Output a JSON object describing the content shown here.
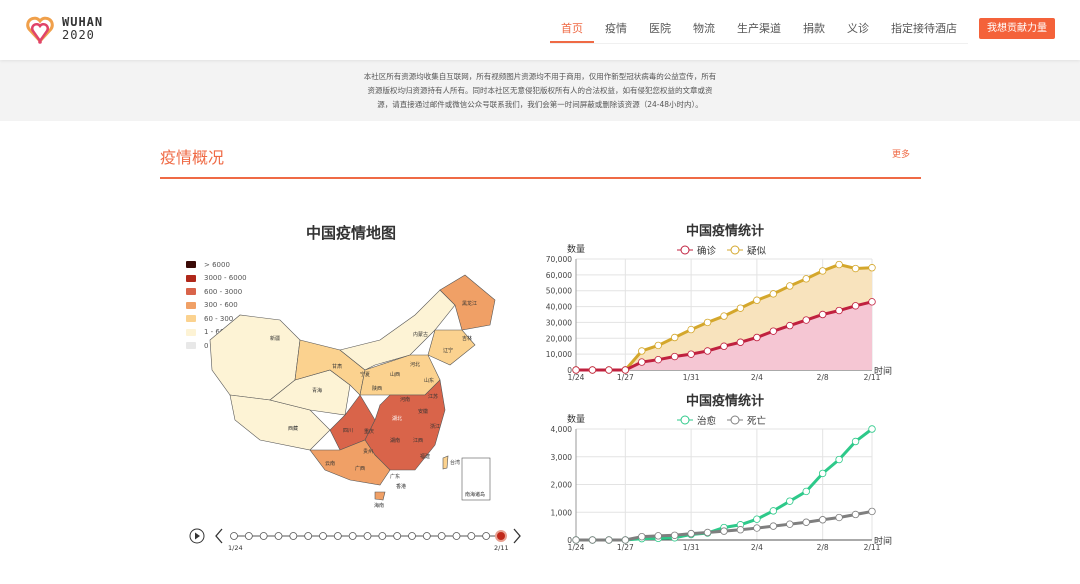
{
  "header": {
    "logo_line1": "WUHAN",
    "logo_line2": "2020",
    "nav": [
      "首页",
      "疫情",
      "医院",
      "物流",
      "生产渠道",
      "捐款",
      "义诊",
      "指定接待酒店"
    ],
    "cta": "我想贡献力量"
  },
  "notice": [
    "本社区所有资源均收集自互联网，所有视频图片资源均不用于商用，仅用作新型冠状病毒的公益宣传，所有",
    "资源版权均归资源持有人所有。同时本社区无意侵犯版权所有人的合法权益，如有侵犯您权益的文章或资",
    "源，请直接通过邮件或微信公众号联系我们，我们会第一时间屏蔽或删除该资源（24-48小时内）。"
  ],
  "section": {
    "title": "疫情概况",
    "more": "更多"
  },
  "map": {
    "title": "中国疫情地图",
    "legend": [
      {
        "label": "> 6000",
        "color": "#3a0a06"
      },
      {
        "label": "3000 - 6000",
        "color": "#b0281a"
      },
      {
        "label": "600 - 3000",
        "color": "#d9644a"
      },
      {
        "label": "300 - 600",
        "color": "#f0a066"
      },
      {
        "label": "60 - 300",
        "color": "#fbd28f"
      },
      {
        "label": "1 - 60",
        "color": "#fdf3d5"
      },
      {
        "label": "0",
        "color": "#e8e8e8"
      }
    ],
    "labels": [
      "新疆",
      "西藏",
      "青海",
      "甘肃",
      "内蒙古",
      "黑龙江",
      "吉林",
      "辽宁",
      "宁夏",
      "陕西",
      "山西",
      "河北",
      "山东",
      "河南",
      "湖北",
      "四川",
      "重庆",
      "湖南",
      "江西",
      "浙江",
      "安徽",
      "江苏",
      "贵州",
      "云南",
      "广西",
      "广东",
      "福建",
      "台湾",
      "香港",
      "海南",
      "南海诸岛"
    ],
    "timeline": {
      "start": "1/24",
      "end": "2/11",
      "count": 19,
      "current": 18
    }
  },
  "chart_data": [
    {
      "type": "line",
      "title": "中国疫情统计",
      "ylabel": "数量",
      "xlabel": "时间",
      "ylim": [
        0,
        70000
      ],
      "yticks": [
        "0",
        "10,000",
        "20,000",
        "30,000",
        "40,000",
        "50,000",
        "60,000",
        "70,000"
      ],
      "ytick_values": [
        0,
        10000,
        20000,
        30000,
        40000,
        50000,
        60000,
        70000
      ],
      "x": [
        "1/24",
        "1/25",
        "1/26",
        "1/27",
        "1/28",
        "1/29",
        "1/30",
        "1/31",
        "2/1",
        "2/2",
        "2/3",
        "2/4",
        "2/5",
        "2/6",
        "2/7",
        "2/8",
        "2/9",
        "2/10",
        "2/11"
      ],
      "xticks": [
        "1/24",
        "1/27",
        "1/31",
        "2/4",
        "2/8",
        "2/11"
      ],
      "series": [
        {
          "name": "确诊",
          "color": "#c0213f",
          "fill": "#f5c6d3",
          "values": [
            0,
            0,
            0,
            0,
            5000,
            6500,
            8500,
            10000,
            12000,
            15000,
            17500,
            20500,
            24500,
            28000,
            31500,
            35000,
            37500,
            40500,
            43000
          ]
        },
        {
          "name": "疑似",
          "color": "#d4a72c",
          "fill": "#f8e3bd",
          "values": [
            0,
            0,
            0,
            0,
            12000,
            15500,
            20500,
            25500,
            30000,
            34000,
            39000,
            44000,
            48000,
            53000,
            57500,
            62500,
            66500,
            64000,
            64500
          ]
        }
      ]
    },
    {
      "type": "line",
      "title": "中国疫情统计",
      "ylabel": "数量",
      "xlabel": "时间",
      "ylim": [
        0,
        4000
      ],
      "yticks": [
        "0",
        "1,000",
        "2,000",
        "3,000",
        "4,000"
      ],
      "ytick_values": [
        0,
        1000,
        2000,
        3000,
        4000
      ],
      "x": [
        "1/24",
        "1/25",
        "1/26",
        "1/27",
        "1/28",
        "1/29",
        "1/30",
        "1/31",
        "2/1",
        "2/2",
        "2/3",
        "2/4",
        "2/5",
        "2/6",
        "2/7",
        "2/8",
        "2/9",
        "2/10",
        "2/11"
      ],
      "xticks": [
        "1/24",
        "1/27",
        "1/31",
        "2/4",
        "2/8",
        "2/11"
      ],
      "series": [
        {
          "name": "治愈",
          "color": "#2ec98a",
          "values": [
            0,
            0,
            0,
            0,
            50,
            60,
            80,
            200,
            250,
            450,
            550,
            750,
            1050,
            1400,
            1750,
            2400,
            2900,
            3550,
            4000
          ]
        },
        {
          "name": "死亡",
          "color": "#7f7f7f",
          "values": [
            0,
            0,
            0,
            0,
            120,
            150,
            170,
            230,
            270,
            320,
            370,
            430,
            500,
            570,
            640,
            730,
            810,
            920,
            1030
          ]
        }
      ]
    }
  ]
}
